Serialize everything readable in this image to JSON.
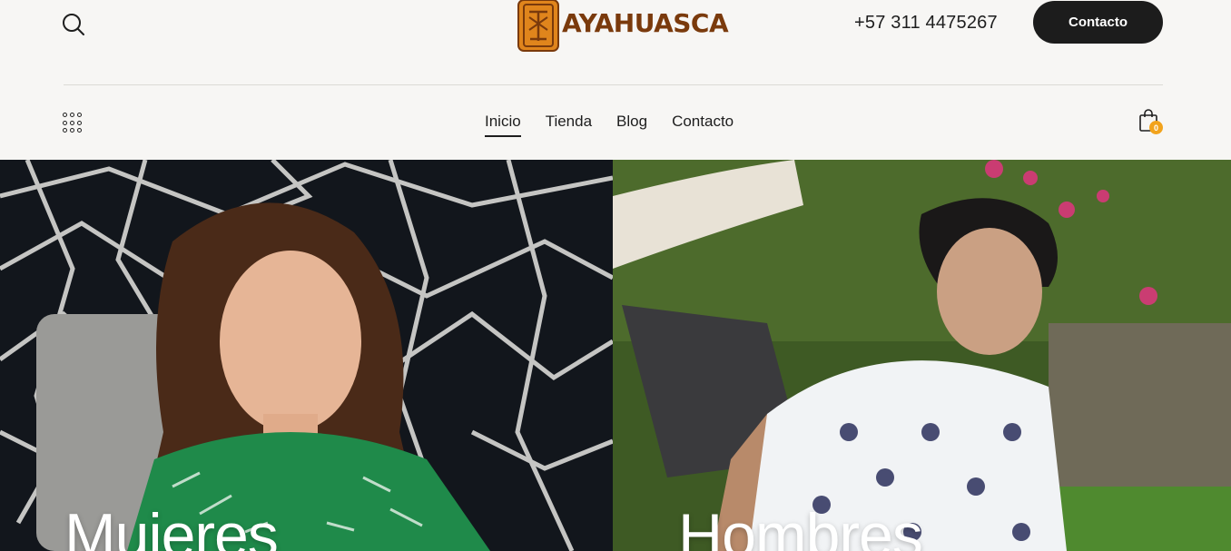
{
  "header": {
    "brand_name": "AYAHUASCA",
    "phone": "+57 311 4475267",
    "cta_label": "Contacto",
    "search_icon": "search-icon",
    "brand_color": "#7a3a0c",
    "logo_orange": "#e0851c"
  },
  "nav": {
    "items": [
      {
        "label": "Inicio",
        "active": true
      },
      {
        "label": "Tienda",
        "active": false
      },
      {
        "label": "Blog",
        "active": false
      },
      {
        "label": "Contacto",
        "active": false
      }
    ],
    "menu_icon": "grid-menu-icon",
    "cart_icon": "shopping-bag-icon",
    "cart_count": "0",
    "badge_color": "#f2a31c"
  },
  "hero": {
    "left_title": "Mujeres",
    "right_title": "Hombres"
  }
}
